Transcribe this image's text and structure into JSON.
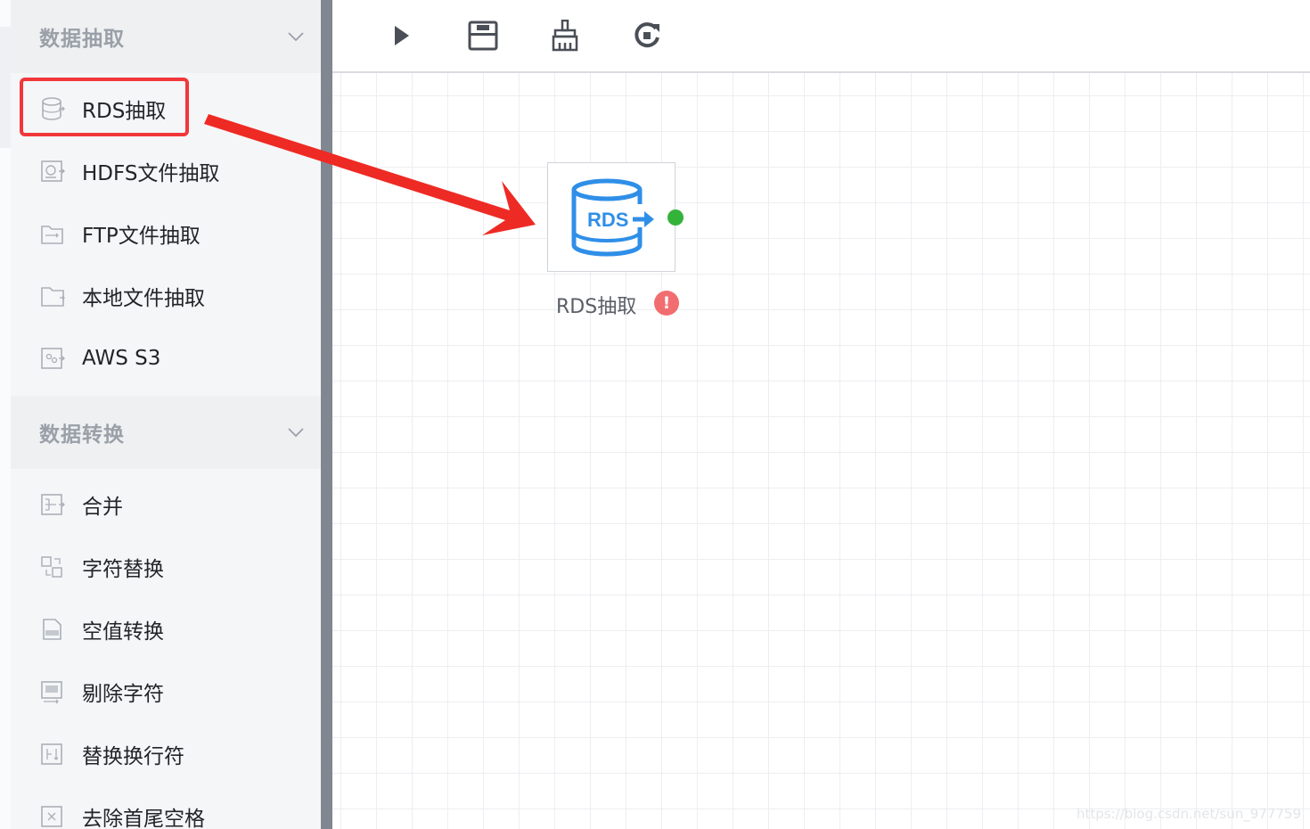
{
  "sidebar": {
    "groups": [
      {
        "title": "数据抽取",
        "items": [
          {
            "label": "RDS抽取",
            "icon": "rds-icon"
          },
          {
            "label": "HDFS文件抽取",
            "icon": "hdfs-icon"
          },
          {
            "label": "FTP文件抽取",
            "icon": "ftp-icon"
          },
          {
            "label": "本地文件抽取",
            "icon": "folder-icon"
          },
          {
            "label": "AWS S3",
            "icon": "s3-icon"
          }
        ]
      },
      {
        "title": "数据转换",
        "items": [
          {
            "label": "合并",
            "icon": "merge-icon"
          },
          {
            "label": "字符替换",
            "icon": "replace-icon"
          },
          {
            "label": "空值转换",
            "icon": "null-convert-icon"
          },
          {
            "label": "剔除字符",
            "icon": "remove-char-icon"
          },
          {
            "label": "替换换行符",
            "icon": "newline-icon"
          },
          {
            "label": "去除首尾空格",
            "icon": "trim-icon"
          }
        ]
      }
    ]
  },
  "toolbar": {
    "buttons": [
      "play-icon",
      "save-icon",
      "clean-icon",
      "refresh-icon"
    ]
  },
  "canvas": {
    "node": {
      "label": "RDS抽取",
      "icon_text": "RDS",
      "status": "!"
    }
  },
  "watermark": "https://blog.csdn.net/sun_977759",
  "colors": {
    "highlight": "#f1373a",
    "arrow": "#ee2a24",
    "node_icon": "#2f8fe8",
    "port": "#34b33b",
    "warning": "#f26d6f"
  }
}
